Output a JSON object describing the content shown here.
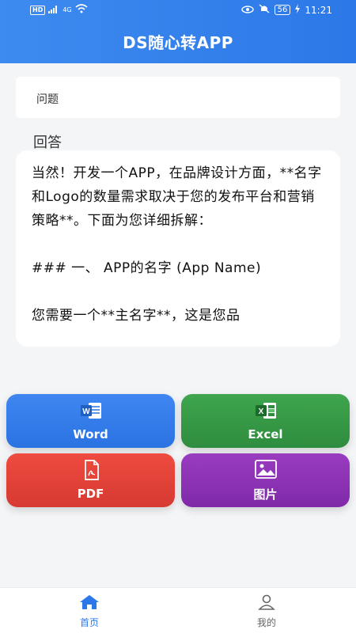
{
  "status_bar": {
    "hd": "HD",
    "signal": "4G",
    "battery": "56",
    "time": "11:21"
  },
  "header": {
    "title": "DS随心转APP"
  },
  "question": {
    "text": "问题"
  },
  "answer": {
    "label": "回答",
    "text": "当然！开发一个APP，在品牌设计方面，**名字和Logo的数量需求取决于您的发布平台和营销策略**。下面为您详细拆解：\n\n### 一、 APP的名字 (App Name)\n\n您需要一个**主名字**，这是您品"
  },
  "actions": {
    "word": "Word",
    "excel": "Excel",
    "pdf": "PDF",
    "image": "图片"
  },
  "colors": {
    "primary": "#2c78e8",
    "word": "#3f86f1",
    "excel": "#3fa54e",
    "pdf": "#ef4b40",
    "image": "#9a3cc0"
  },
  "nav": {
    "home": "首页",
    "mine": "我的"
  }
}
